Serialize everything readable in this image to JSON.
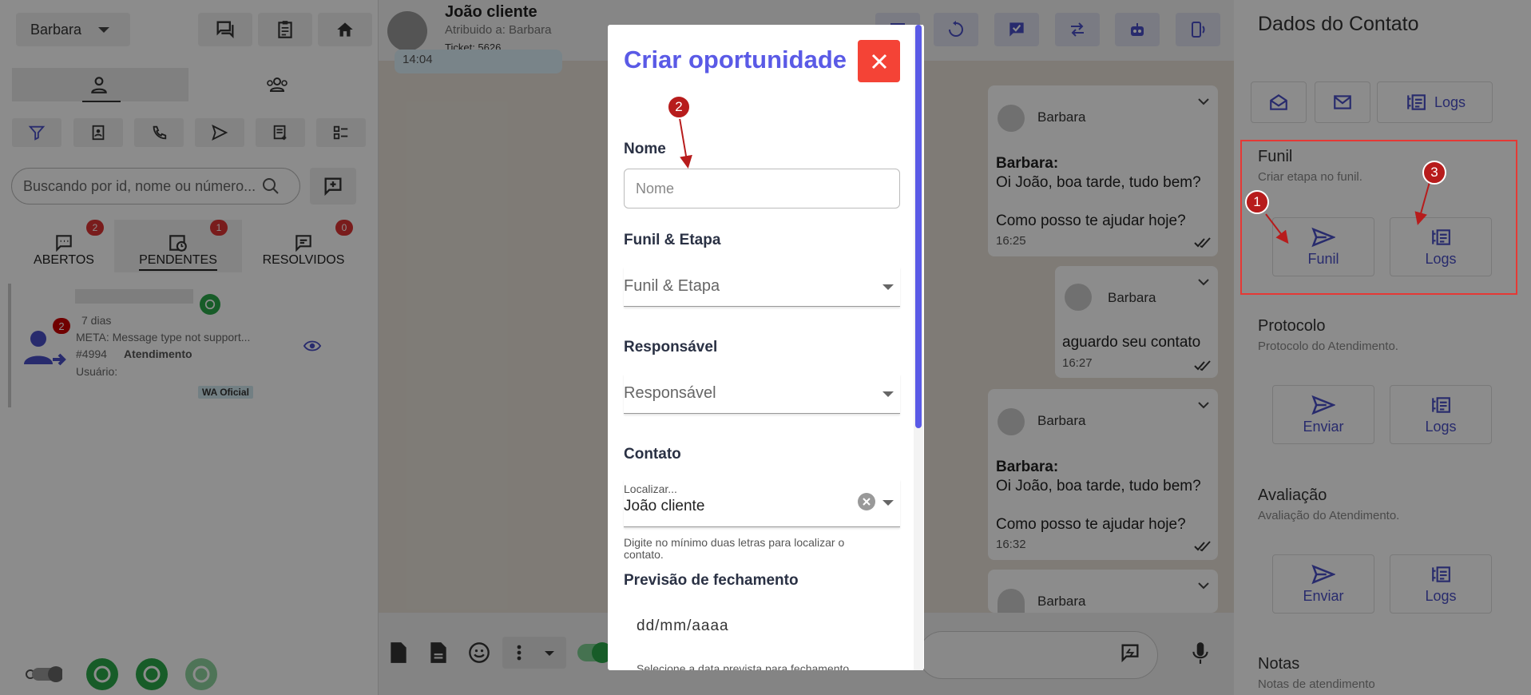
{
  "left": {
    "user": "Barbara",
    "search_placeholder": "Buscando por id, nome ou número...",
    "status_tabs": [
      {
        "label": "ABERTOS",
        "count": "2"
      },
      {
        "label": "PENDENTES",
        "count": "1"
      },
      {
        "label": "RESOLVIDOS",
        "count": "0"
      }
    ],
    "ticket": {
      "badge": "2",
      "age": "7 dias",
      "preview": "META: Message type not support...",
      "id": "#4994",
      "status": "Atendimento",
      "user_label": "Usuário:",
      "channel": "WA Oficial"
    }
  },
  "chat": {
    "contact_name": "João cliente",
    "assigned": "Atribuido a: Barbara",
    "ticket": "Ticket: 5626",
    "top_time": "14:04",
    "messages": [
      {
        "from": "Barbara",
        "sender": "Barbara:",
        "line1": "Oi João, boa tarde, tudo bem?",
        "line2": "Como posso te ajudar hoje?",
        "time": "16:25"
      },
      {
        "from": "Barbara",
        "text": "aguardo seu contato",
        "time": "16:27"
      },
      {
        "from": "Barbara",
        "sender": "Barbara:",
        "line1": "Oi João, boa tarde, tudo bem?",
        "line2": "Como posso te ajudar hoje?",
        "time": "16:32"
      },
      {
        "from": "Barbara"
      }
    ]
  },
  "modal": {
    "title": "Criar oportunidade",
    "nome_label": "Nome",
    "nome_placeholder": "Nome",
    "funil_label": "Funil & Etapa",
    "funil_value": "Funil & Etapa",
    "resp_label": "Responsável",
    "resp_value": "Responsável",
    "contato_label": "Contato",
    "contato_small": "Localizar...",
    "contato_value": "João cliente",
    "contato_hint": "Digite no mínimo duas letras para localizar o contato.",
    "previsao_label": "Previsão de fechamento",
    "previsao_placeholder": "dd/mm/aaaa",
    "previsao_hint": "Selecione a data prevista para fechamento"
  },
  "right": {
    "title": "Dados do Contato",
    "logs_label": "Logs",
    "sections": [
      {
        "title": "Funil",
        "subtitle": "Criar etapa no funil.",
        "btn1": "Funil",
        "btn2": "Logs"
      },
      {
        "title": "Protocolo",
        "subtitle": "Protocolo do Atendimento.",
        "btn1": "Enviar",
        "btn2": "Logs"
      },
      {
        "title": "Avaliação",
        "subtitle": "Avaliação do Atendimento.",
        "btn1": "Enviar",
        "btn2": "Logs"
      },
      {
        "title": "Notas",
        "subtitle": "Notas de atendimento"
      }
    ]
  },
  "markers": [
    "1",
    "2",
    "3"
  ],
  "colors": {
    "accent": "#5a5ae6",
    "close": "#f44336",
    "annotation": "#b71c1c",
    "whatsapp": "#2aa84a"
  }
}
